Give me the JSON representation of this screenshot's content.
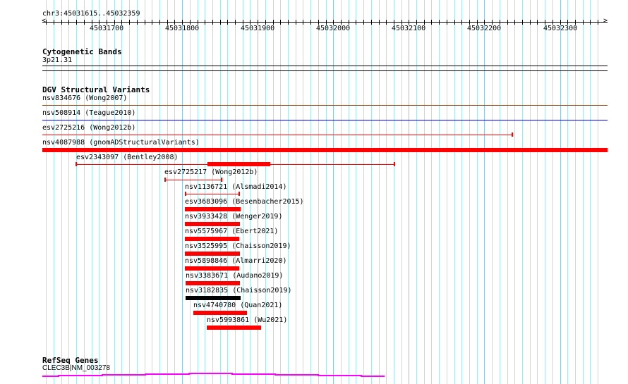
{
  "ruler": {
    "location": "chr3:45031615..45032359",
    "start": 45031615,
    "end": 45032359,
    "labels": [
      "45031700",
      "45031800",
      "45031900",
      "45032000",
      "45032100",
      "45032200",
      "45032300"
    ]
  },
  "cytoband": {
    "title": "Cytogenetic Bands",
    "band": "3p21.31"
  },
  "dgv": {
    "title": "DGV Structural Variants",
    "features": [
      {
        "label": "nsv834676 (Wong2007)",
        "color": "#8b4513"
      },
      {
        "label": "nsv508914 (Teague2010)",
        "color": "#0000ff"
      },
      {
        "label": "esv2725216 (Wong2012b)",
        "color": "#ff0000"
      },
      {
        "label": "nsv4087988 (gnomADStructuralVariants)",
        "color": "#ff0000"
      },
      {
        "label": "esv2343097 (Bentley2008)",
        "color": "#ff0000"
      },
      {
        "label": "esv2725217 (Wong2012b)",
        "color": "#ff0000"
      },
      {
        "label": "nsv1136721 (Alsmadi2014)",
        "color": "#ff0000"
      },
      {
        "label": "esv3683096 (Besenbacher2015)",
        "color": "#ff0000"
      },
      {
        "label": "nsv3933428 (Wenger2019)",
        "color": "#ff0000"
      },
      {
        "label": "nsv5575967 (Ebert2021)",
        "color": "#ff0000"
      },
      {
        "label": "nsv3525995 (Chaisson2019)",
        "color": "#ff0000"
      },
      {
        "label": "nsv5898846 (Almarri2020)",
        "color": "#ff0000"
      },
      {
        "label": "nsv3383671 (Audano2019)",
        "color": "#ff0000"
      },
      {
        "label": "nsv3182835 (Chaisson2019)",
        "color": "#000000"
      },
      {
        "label": "nsv4740780 (Quan2021)",
        "color": "#ff0000"
      },
      {
        "label": "nsv5993861 (Wu2021)",
        "color": "#ff0000"
      }
    ]
  },
  "refseq": {
    "title": "RefSeq Genes",
    "gene": "CLEC3B|NM_003278",
    "color": "#ff00ff"
  }
}
